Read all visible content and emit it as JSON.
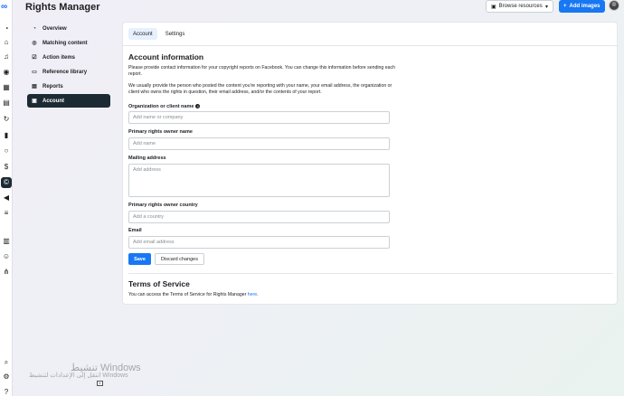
{
  "header": {
    "app_title": "Rights Manager",
    "browse_label": "Browse resources",
    "add_label": "Add images"
  },
  "nav": {
    "items": [
      {
        "label": "Overview",
        "icon": "gauge-icon"
      },
      {
        "label": "Matching content",
        "icon": "eye-icon"
      },
      {
        "label": "Action items",
        "icon": "checklist-icon"
      },
      {
        "label": "Reference library",
        "icon": "folder-icon"
      },
      {
        "label": "Reports",
        "icon": "report-icon"
      },
      {
        "label": "Account",
        "icon": "account-icon"
      }
    ]
  },
  "tabs": [
    {
      "label": "Account"
    },
    {
      "label": "Settings"
    }
  ],
  "account": {
    "heading": "Account information",
    "intro": "Please provide contact information for your copyright reports on Facebook. You can change this information before sending each report.",
    "intro2": "We usually provide the person who posted the content you're reporting with your name, your email address, the organization or client who owns the rights in question, their email address, and/or the contents of your report.",
    "org_label": "Organization or client name",
    "org_placeholder": "Add name or company",
    "owner_label": "Primary rights owner name",
    "owner_placeholder": "Add name",
    "address_label": "Mailing address",
    "address_placeholder": "Add address",
    "country_label": "Primary rights owner country",
    "country_placeholder": "Add a country",
    "email_label": "Email",
    "email_placeholder": "Add email address",
    "save_label": "Save",
    "discard_label": "Discard changes"
  },
  "terms": {
    "heading": "Terms of Service",
    "text": "You can access the Terms of Service for Rights Manager ",
    "link": "here",
    "end": "."
  },
  "watermark": {
    "line1": "تنشيط Windows",
    "line2": "انتقل إلى الإعدادات لتنشيط Windows"
  },
  "colors": {
    "accent": "#1877f2",
    "active_nav": "#1c2b33"
  }
}
